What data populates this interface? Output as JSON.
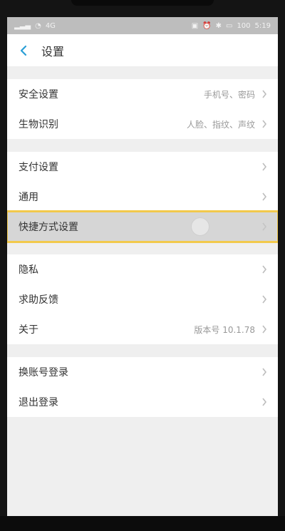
{
  "status": {
    "time": "5:19",
    "signal_text": "4G",
    "battery_text": "100"
  },
  "header": {
    "title": "设置"
  },
  "groups": [
    {
      "items": [
        {
          "label": "安全设置",
          "value": "手机号、密码"
        },
        {
          "label": "生物识别",
          "value": "人脸、指纹、声纹"
        }
      ]
    },
    {
      "items": [
        {
          "label": "支付设置",
          "value": ""
        },
        {
          "label": "通用",
          "value": ""
        },
        {
          "label": "快捷方式设置",
          "value": ""
        }
      ]
    },
    {
      "items": [
        {
          "label": "隐私",
          "value": ""
        },
        {
          "label": "求助反馈",
          "value": ""
        },
        {
          "label": "关于",
          "value": "版本号 10.1.78"
        }
      ]
    },
    {
      "items": [
        {
          "label": "换账号登录",
          "value": ""
        },
        {
          "label": "退出登录",
          "value": ""
        }
      ]
    }
  ],
  "colors": {
    "accent": "#2a9fd6",
    "highlight_outline": "#f2c94c"
  }
}
